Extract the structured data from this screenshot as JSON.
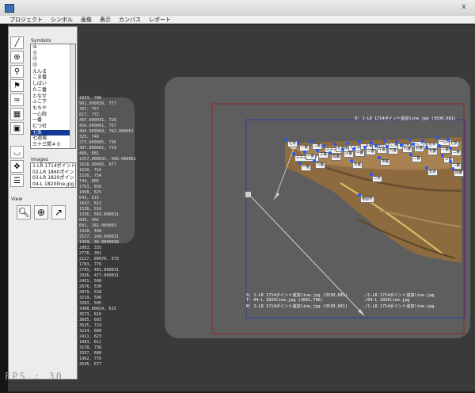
{
  "window": {
    "close_glyph": "x"
  },
  "menu": [
    "プロジェクト",
    "シンボル",
    "画像",
    "表示",
    "カンバス",
    "レポート"
  ],
  "panel": {
    "symbols_label": "Symbols",
    "symbols": [
      "⑩",
      "⑪",
      "⑫",
      "⑬",
      "えんま",
      "こま番",
      "しばい",
      "たこ番",
      "となせ",
      "ふこ下",
      "もちや",
      "一心院",
      "一番",
      "むつ社",
      "七条",
      "七週場",
      "三十三間４０"
    ],
    "selected_symbol_index": 14,
    "images_label": "Images",
    "images": [
      "1-LR 1714ポイント追加line.jpg",
      "02-LR 1860ポイント追加line.jpg",
      "03-LR 1820ポイント追加line.jpg",
      "04-L 1820line.jpg"
    ],
    "view_label": "View"
  },
  "coords": [
    "1033, 786",
    "961.999939, 777",
    "707, 757",
    "617, 772",
    "497.000031, 726",
    "456.000061, 757",
    "404.999969, 762.000061",
    "325, 746",
    "273.999985, 736",
    "307.000061, 719",
    "468, 681",
    "1257.000031, 666.000061",
    "1616.99995, 677",
    "1630, 716",
    "1526, 754",
    "744, 805",
    "1763, 656",
    "1068, 625",
    "643, 615",
    "1647, 612",
    "1536, 516",
    "1336, 565.000031",
    "699, 402",
    "602, 182.000003",
    "1928, 448",
    "2577, 249.000031",
    "1459, 36.0000038",
    "2083, 335",
    "2778, 301",
    "2127, 89076, 373",
    "1783, 776",
    "2795, 491.000031",
    "2926, 477.000031",
    "2451, 508",
    "2676, 530",
    "2879, 528",
    "3219, 596",
    "3283, 595",
    "3408.00024, 615",
    "3573, 616",
    "3605, 693",
    "3625, 724",
    "3214, 680",
    "2411, 623",
    "1883, 611",
    "3178, 736",
    "3337, 688",
    "1962, 776",
    "2545, 677"
  ],
  "fps": "FPS : 30",
  "canvas_header": "0: 1-LR 1714ポイント追加line.jpg (3530,681)",
  "status_lines": [
    {
      "left": "0: 1-LR 1714ポイント追加line.jpg (3530,681)",
      "right": "./1-LR 1714ポイント追加line.jpg"
    },
    {
      "left": "T: 04-L 1820line.jpg (3661,796)",
      "right": "./04-L 1820line.jpg"
    },
    {
      "left": "M: 1-LR 1714ポイント追加line.jpg (3530,681)",
      "right": "./1-LR 1714ポイント追加line.jpg"
    }
  ],
  "badges": [
    "七条",
    "一番",
    "二番",
    "三十三間",
    "七週場",
    "えんま",
    "こま番",
    "しばい",
    "たこ番",
    "となせ",
    "ふこ下",
    "もちや",
    "一心院",
    "七条",
    "三十三間４０",
    "一番",
    "三番",
    "四番",
    "小番",
    "一番",
    "二番",
    "十番",
    "六番",
    "八番",
    "お番",
    "九番",
    "一番",
    "二番",
    "一番",
    "八番",
    "大番",
    "寺番",
    "二番",
    "三番",
    "相国寺",
    "二条",
    "北条",
    "一番",
    "四番"
  ]
}
